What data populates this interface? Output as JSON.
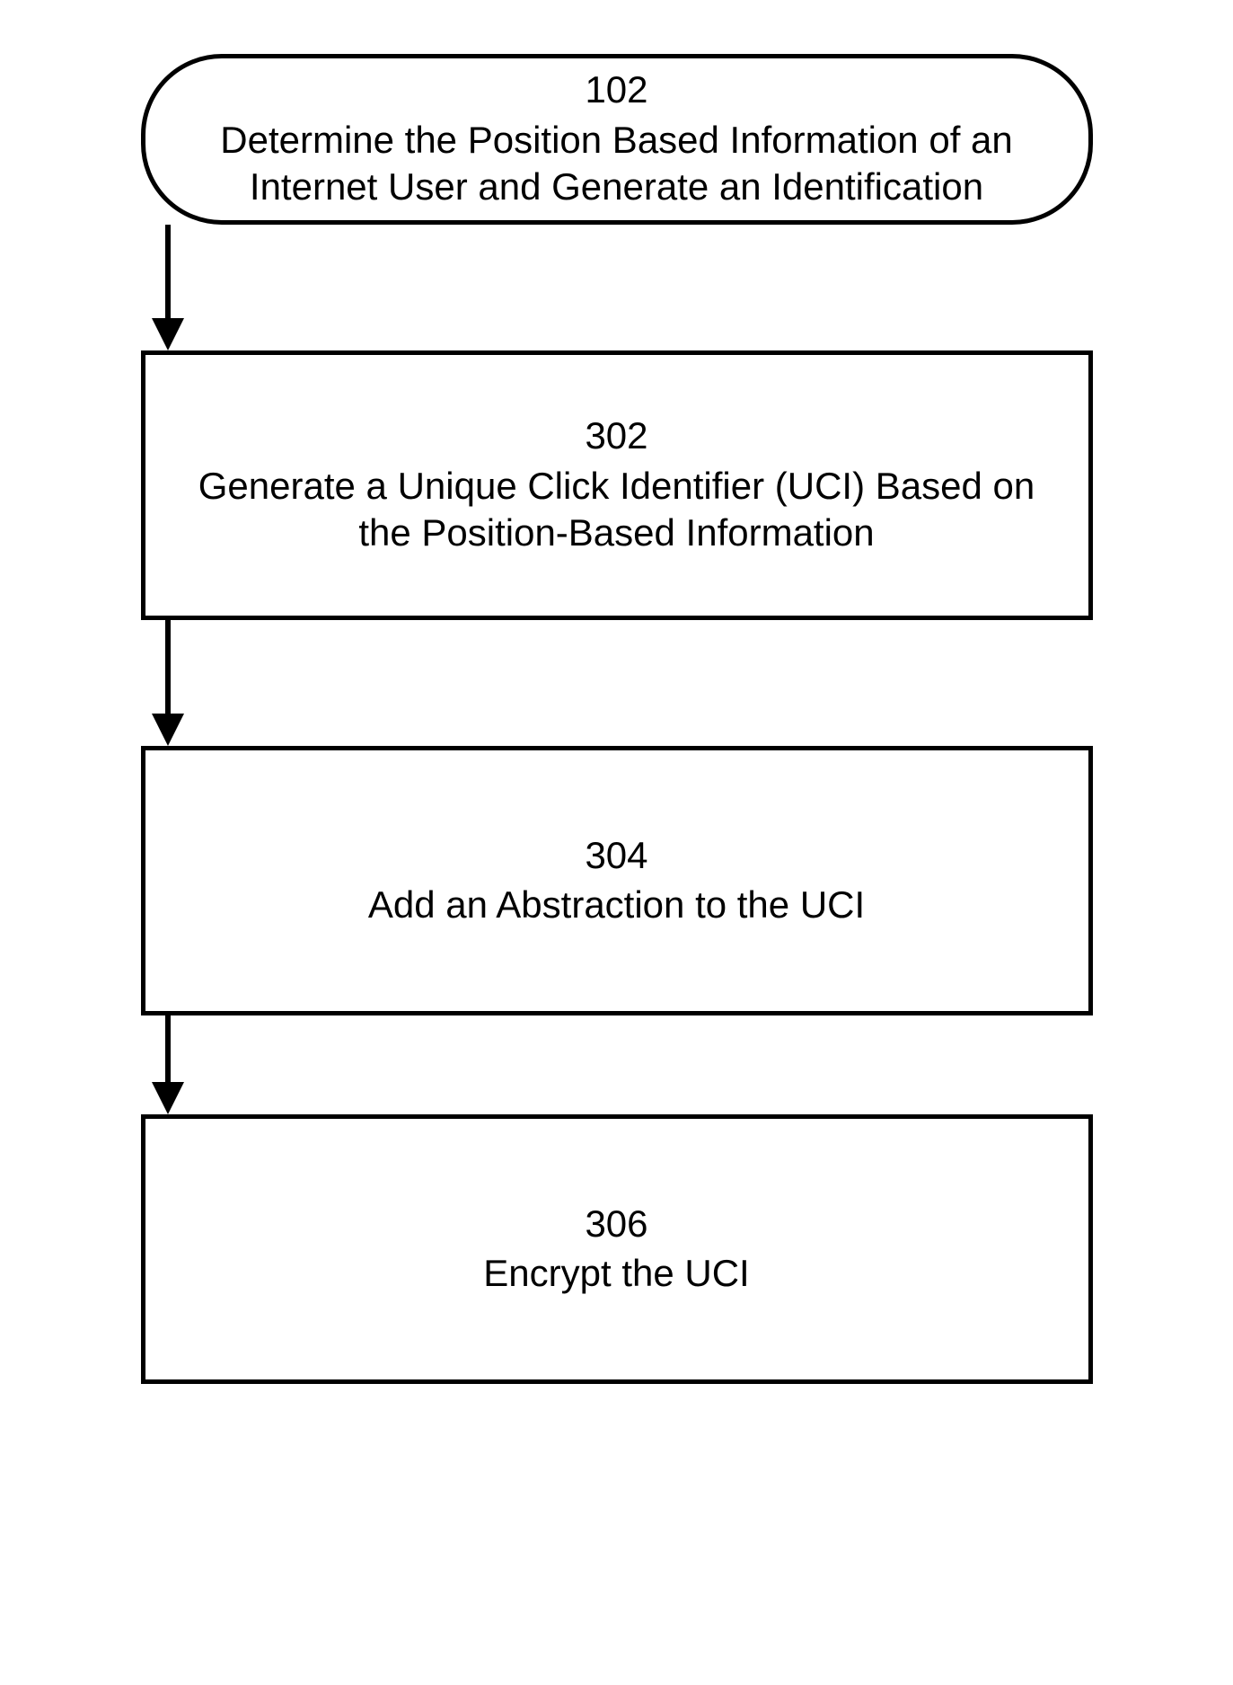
{
  "diagram": {
    "type": "flowchart",
    "nodes": [
      {
        "id": "102",
        "shape": "terminator",
        "number": "102",
        "text": "Determine the Position Based Information of an Internet User and Generate an Identification"
      },
      {
        "id": "302",
        "shape": "process",
        "number": "302",
        "text": "Generate a Unique Click Identifier (UCI) Based on the Position-Based Information"
      },
      {
        "id": "304",
        "shape": "process",
        "number": "304",
        "text": "Add an Abstraction to the UCI"
      },
      {
        "id": "306",
        "shape": "process",
        "number": "306",
        "text": "Encrypt the UCI"
      }
    ],
    "edges": [
      {
        "from": "102",
        "to": "302"
      },
      {
        "from": "302",
        "to": "304"
      },
      {
        "from": "304",
        "to": "306"
      }
    ]
  }
}
